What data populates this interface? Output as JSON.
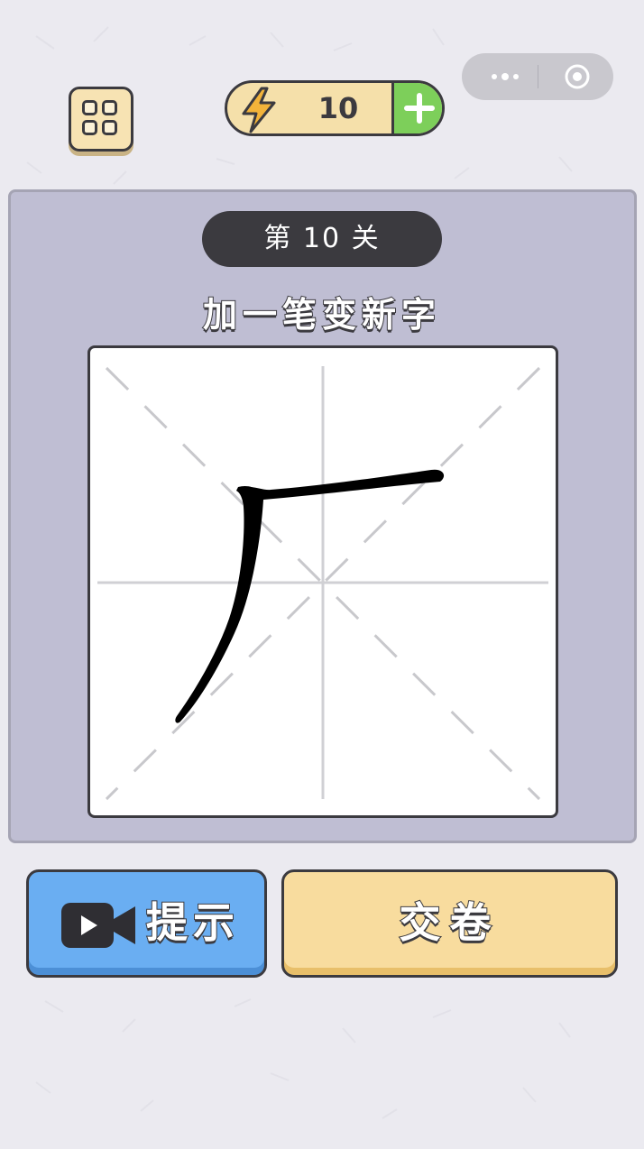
{
  "topbar": {
    "menu_icon": "grid-menu-icon",
    "energy": {
      "icon": "lightning-bolt-icon",
      "count": "10",
      "add_icon": "plus-icon"
    },
    "capsule": {
      "more_icon": "more-dots-icon",
      "close_icon": "target-close-icon"
    }
  },
  "level": {
    "label": "第 10 关"
  },
  "puzzle": {
    "instruction": "加一笔变新字",
    "character": "厂",
    "grid_style": "mi-zi-ge"
  },
  "actions": {
    "hint": {
      "icon": "video-camera-icon",
      "label": "提示"
    },
    "submit": {
      "label": "交卷"
    }
  },
  "colors": {
    "background": "#ebeaf0",
    "board": "#bfbed3",
    "hint_button": "#6aaef2",
    "submit_button": "#f8dc9e",
    "energy_plus": "#7dcf5a",
    "ink": "#3b3a3f"
  }
}
